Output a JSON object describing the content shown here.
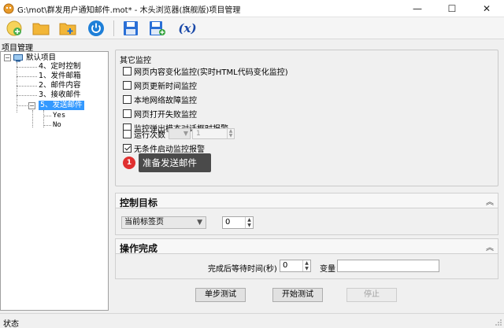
{
  "window": {
    "title": "G:\\mot\\群发用户通知邮件.mot* - 木头浏览器(旗舰版)项目管理",
    "minimize_glyph": "—",
    "maximize_glyph": "☐",
    "close_glyph": "✕"
  },
  "toolbar": {
    "icons": [
      "new-project-icon",
      "open-folder-icon",
      "add-folder-icon",
      "power-icon",
      "save-icon",
      "save-as-icon",
      "variable-icon"
    ],
    "variable_label": "(x)"
  },
  "project_tree": {
    "title": "项目管理",
    "root": "默认项目",
    "items": [
      "4、定时控制",
      "1、发件邮箱",
      "2、邮件内容",
      "3、接收邮件",
      "5、发送邮件"
    ],
    "selected": "5、发送邮件",
    "sub_items": [
      "Yes",
      "No"
    ],
    "toggle_minus": "−"
  },
  "other_monitor": {
    "title": "其它监控",
    "options": [
      {
        "label": "网页内容变化监控(实时HTML代码变化监控)",
        "checked": false
      },
      {
        "label": "网页更新时间监控",
        "checked": false
      },
      {
        "label": "本地网络故障监控",
        "checked": false
      },
      {
        "label": "网页打开失败监控",
        "checked": false
      },
      {
        "label": "监控弹出模态对话框时报警",
        "checked": false
      },
      {
        "label": "运行次数",
        "checked": false
      },
      {
        "label": "无条件启动监控报警",
        "checked": true
      }
    ],
    "run_count_value": "1",
    "badge": "1",
    "tooltip": "准备发送邮件"
  },
  "control_target": {
    "title": "控制目标",
    "selected": "当前标签页",
    "index_value": "0",
    "collapse_glyph": "︽"
  },
  "operation_done": {
    "title": "操作完成",
    "wait_label": "完成后等待时间(秒)",
    "wait_value": "0",
    "variable_label": "变量",
    "variable_value": "",
    "collapse_glyph": "︽"
  },
  "buttons": {
    "step_test": "单步测试",
    "start_test": "开始测试",
    "stop": "停止"
  },
  "status": {
    "text": "状态"
  }
}
